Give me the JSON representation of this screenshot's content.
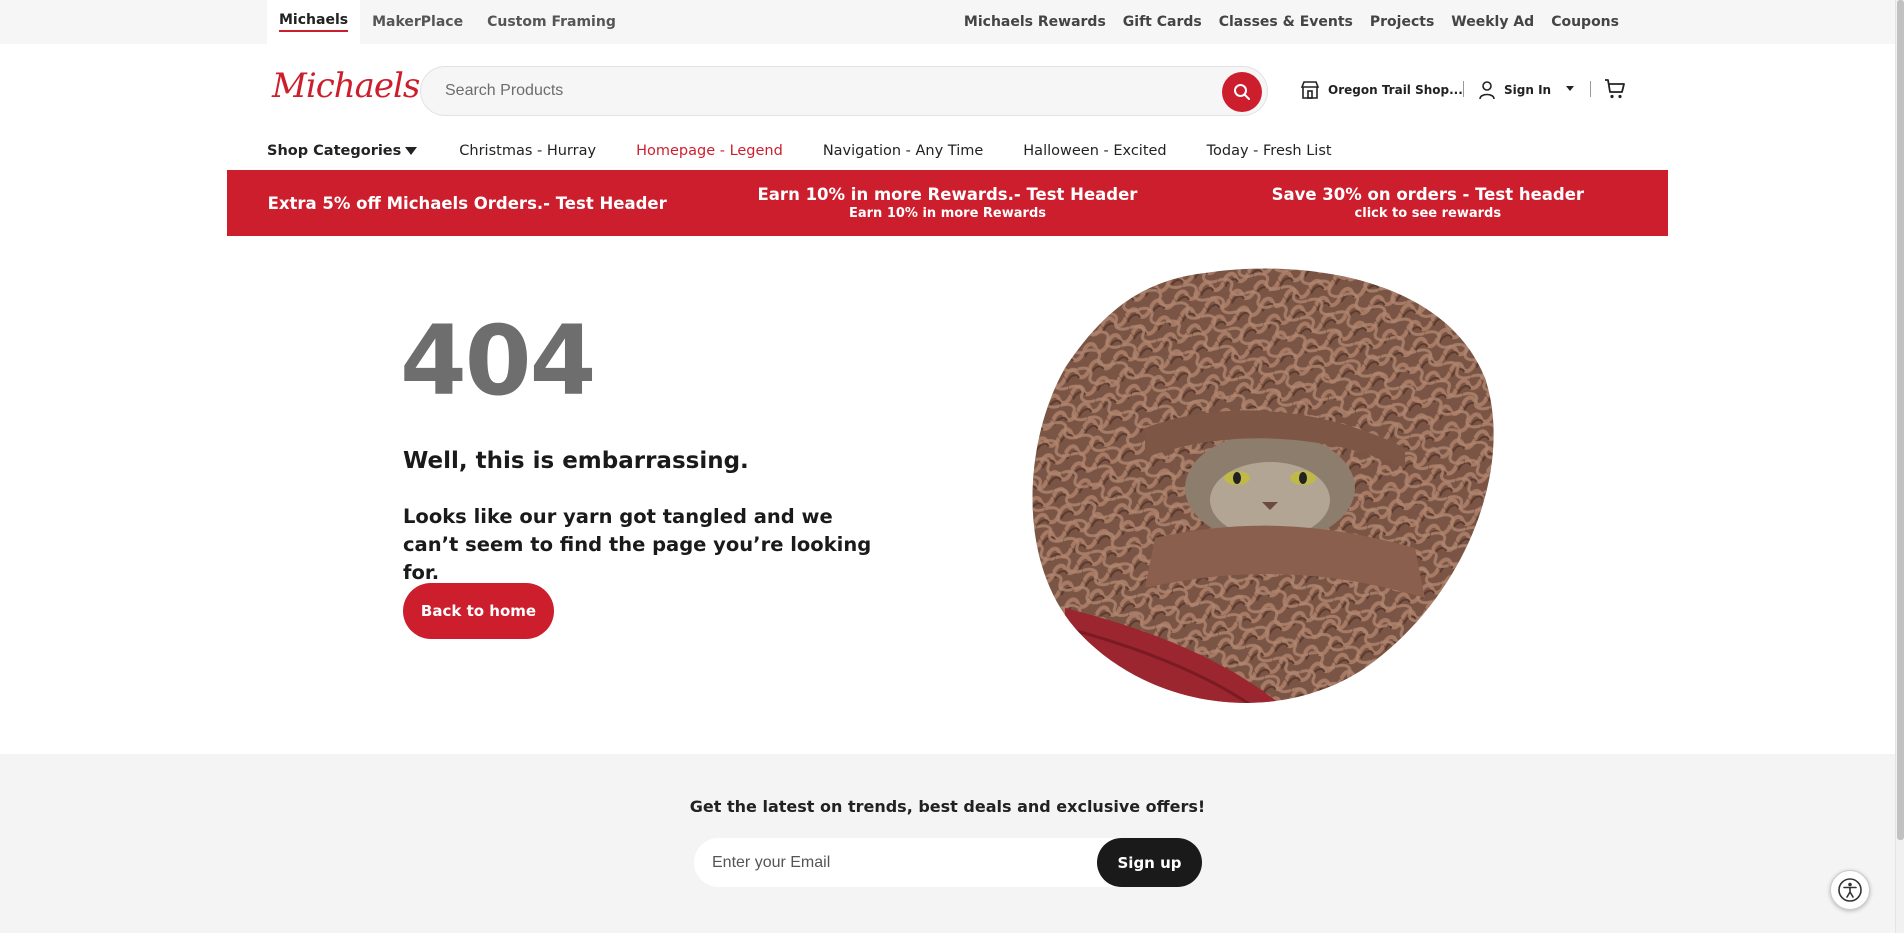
{
  "topbar": {
    "brand_tabs": [
      "Michaels",
      "MakerPlace",
      "Custom Framing"
    ],
    "util_links": [
      "Michaels Rewards",
      "Gift Cards",
      "Classes & Events",
      "Projects",
      "Weekly Ad",
      "Coupons"
    ]
  },
  "header": {
    "logo": "Michaels",
    "search_placeholder": "Search Products",
    "store": "Oregon Trail Shop...",
    "signin": "Sign In"
  },
  "nav": {
    "categories": "Shop Categories",
    "items": [
      "Christmas - Hurray",
      "Homepage - Legend",
      "Navigation - Any Time",
      "Halloween - Excited",
      "Today - Fresh List"
    ]
  },
  "promo": [
    {
      "title": "Extra 5% off Michaels Orders.- Test Header",
      "sub": ""
    },
    {
      "title": "Earn 10% in more Rewards.- Test Header",
      "sub": "Earn 10% in more Rewards"
    },
    {
      "title": "Save 30% on orders - Test header",
      "sub": "click to see rewards"
    }
  ],
  "error": {
    "code": "404",
    "title": "Well, this is embarrassing.",
    "description": "Looks like our yarn got tangled and we can’t seem to find the page you’re looking for.",
    "button": "Back to home"
  },
  "footer": {
    "newsletter": "Get the latest on trends, best deals and exclusive offers!",
    "email_placeholder": "Enter your Email",
    "signup": "Sign up"
  },
  "colors": {
    "brand_red": "#cd1e2d",
    "dark": "#1a1a1a",
    "error_gray": "#6e6e6e"
  },
  "icons": [
    "search-icon",
    "store-icon",
    "user-icon",
    "chevron-down-icon",
    "cart-icon",
    "caret-down-icon",
    "accessibility-icon"
  ]
}
